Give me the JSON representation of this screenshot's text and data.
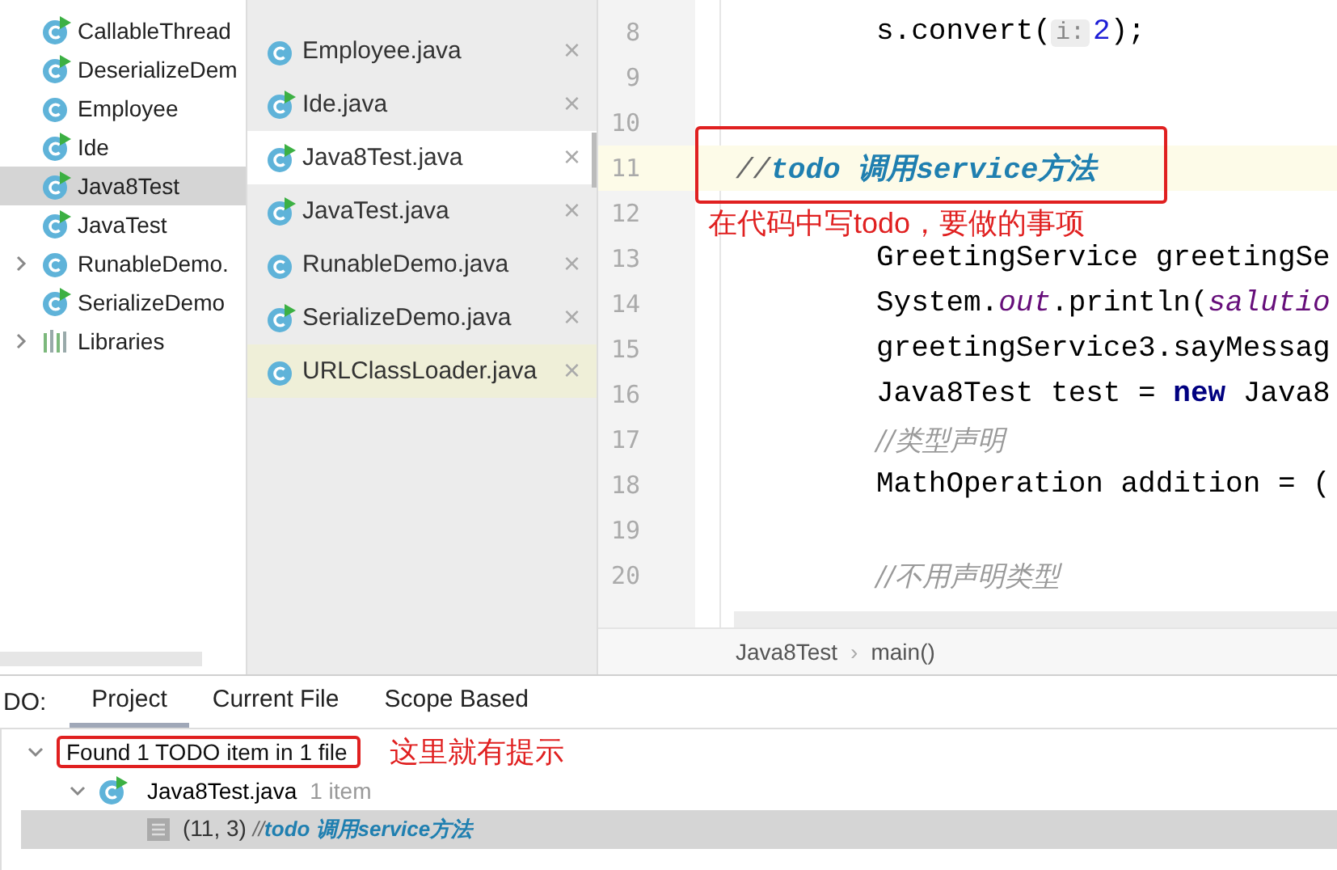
{
  "project_tree": {
    "items": [
      {
        "label": "CallableThread",
        "kind": "runnable-class",
        "selected": false
      },
      {
        "label": "DeserializeDem",
        "kind": "runnable-class",
        "selected": false
      },
      {
        "label": "Employee",
        "kind": "class",
        "selected": false
      },
      {
        "label": "Ide",
        "kind": "runnable-class",
        "selected": false
      },
      {
        "label": "Java8Test",
        "kind": "runnable-class",
        "selected": true
      },
      {
        "label": "JavaTest",
        "kind": "runnable-class",
        "selected": false
      },
      {
        "label": "RunableDemo.",
        "kind": "class",
        "selected": false,
        "expanded": false
      },
      {
        "label": "SerializeDemo",
        "kind": "runnable-class",
        "selected": false
      },
      {
        "label": "Libraries",
        "kind": "library",
        "selected": false,
        "expanded": false
      }
    ]
  },
  "recent_files": {
    "items": [
      {
        "label": "Employee.java",
        "kind": "class",
        "selected": false,
        "highlighted": false
      },
      {
        "label": "Ide.java",
        "kind": "runnable-class",
        "selected": false,
        "highlighted": false
      },
      {
        "label": "Java8Test.java",
        "kind": "runnable-class",
        "selected": true,
        "highlighted": false
      },
      {
        "label": "JavaTest.java",
        "kind": "runnable-class",
        "selected": false,
        "highlighted": false
      },
      {
        "label": "RunableDemo.java",
        "kind": "class",
        "selected": false,
        "highlighted": false
      },
      {
        "label": "SerializeDemo.java",
        "kind": "runnable-class",
        "selected": false,
        "highlighted": false
      },
      {
        "label": "URLClassLoader.java",
        "kind": "class",
        "selected": false,
        "highlighted": true
      }
    ],
    "close_glyph": "×"
  },
  "editor": {
    "lines": [
      {
        "number": "8",
        "kind": "code",
        "current": false,
        "segments": [
          {
            "text": "s.convert(",
            "kind": "plain"
          },
          {
            "text": "i:",
            "kind": "hint"
          },
          {
            "text": "2",
            "kind": "number"
          },
          {
            "text": ");",
            "kind": "plain"
          }
        ]
      },
      {
        "number": "9",
        "kind": "blank",
        "current": false
      },
      {
        "number": "10",
        "kind": "blank",
        "current": false
      },
      {
        "number": "11",
        "kind": "todo",
        "current": true,
        "segments": [
          {
            "text": "//",
            "kind": "comment-slash"
          },
          {
            "text": "todo 调用service方法",
            "kind": "todo"
          }
        ]
      },
      {
        "number": "12",
        "kind": "blank",
        "current": false
      },
      {
        "number": "13",
        "kind": "code",
        "current": false,
        "segments": [
          {
            "text": "GreetingService greetingSe",
            "kind": "plain"
          }
        ]
      },
      {
        "number": "14",
        "kind": "code",
        "current": false,
        "segments": [
          {
            "text": "System.",
            "kind": "plain"
          },
          {
            "text": "out",
            "kind": "static"
          },
          {
            "text": ".println(",
            "kind": "plain"
          },
          {
            "text": "salutio",
            "kind": "static"
          }
        ]
      },
      {
        "number": "15",
        "kind": "code",
        "current": false,
        "segments": [
          {
            "text": "greetingService3.sayMessag",
            "kind": "plain"
          }
        ]
      },
      {
        "number": "16",
        "kind": "code",
        "current": false,
        "segments": [
          {
            "text": "Java8Test test = ",
            "kind": "plain"
          },
          {
            "text": "new",
            "kind": "keyword"
          },
          {
            "text": " Java8",
            "kind": "plain"
          }
        ]
      },
      {
        "number": "17",
        "kind": "code",
        "current": false,
        "segments": [
          {
            "text": "//类型声明",
            "kind": "comment"
          }
        ]
      },
      {
        "number": "18",
        "kind": "code",
        "current": false,
        "segments": [
          {
            "text": "MathOperation addition = (",
            "kind": "plain"
          }
        ]
      },
      {
        "number": "19",
        "kind": "blank",
        "current": false
      },
      {
        "number": "20",
        "kind": "code",
        "current": false,
        "segments": [
          {
            "text": "//不用声明类型",
            "kind": "comment"
          }
        ]
      }
    ],
    "annotation": "在代码中写todo，要做的事项",
    "breadcrumbs": [
      "Java8Test",
      "main()"
    ],
    "breadcrumb_separator": "›"
  },
  "todo_panel": {
    "title": "DO:",
    "tabs": [
      {
        "label": "Project",
        "selected": true
      },
      {
        "label": "Current File",
        "selected": false
      },
      {
        "label": "Scope Based",
        "selected": false
      }
    ],
    "summary": {
      "label": "Found 1 TODO item in 1 file",
      "expanded": true,
      "annotation": "这里就有提示"
    },
    "file": {
      "label": "Java8Test.java",
      "count": "1 item",
      "expanded": true
    },
    "item": {
      "position": "(11, 3)",
      "slash": "//",
      "text": "todo 调用service方法",
      "selected": true
    }
  }
}
